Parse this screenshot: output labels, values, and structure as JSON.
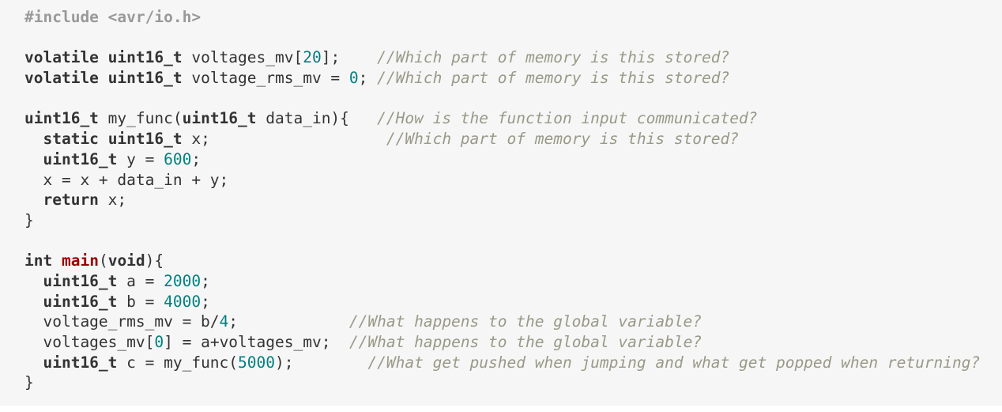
{
  "colors": {
    "background": "#f6f6f6",
    "text": "#333333",
    "keyword": "#333333",
    "preprocessor": "#999999",
    "number": "#008080",
    "function_name": "#990000",
    "comment": "#999988"
  },
  "lines": [
    {
      "tokens": [
        {
          "t": "pp",
          "v": "#include <avr/io.h>"
        }
      ]
    },
    {
      "tokens": []
    },
    {
      "tokens": [
        {
          "t": "kw",
          "v": "volatile"
        },
        {
          "t": "plain",
          "v": " "
        },
        {
          "t": "kw",
          "v": "uint16_t"
        },
        {
          "t": "plain",
          "v": " voltages_mv["
        },
        {
          "t": "num",
          "v": "20"
        },
        {
          "t": "plain",
          "v": "];    "
        },
        {
          "t": "cm",
          "v": "//Which part of memory is this stored?"
        }
      ]
    },
    {
      "tokens": [
        {
          "t": "kw",
          "v": "volatile"
        },
        {
          "t": "plain",
          "v": " "
        },
        {
          "t": "kw",
          "v": "uint16_t"
        },
        {
          "t": "plain",
          "v": " voltage_rms_mv = "
        },
        {
          "t": "num",
          "v": "0"
        },
        {
          "t": "plain",
          "v": "; "
        },
        {
          "t": "cm",
          "v": "//Which part of memory is this stored?"
        }
      ]
    },
    {
      "tokens": []
    },
    {
      "tokens": [
        {
          "t": "kw",
          "v": "uint16_t"
        },
        {
          "t": "plain",
          "v": " my_func("
        },
        {
          "t": "kw",
          "v": "uint16_t"
        },
        {
          "t": "plain",
          "v": " data_in){   "
        },
        {
          "t": "cm",
          "v": "//How is the function input communicated?"
        }
      ]
    },
    {
      "tokens": [
        {
          "t": "plain",
          "v": "  "
        },
        {
          "t": "kw",
          "v": "static"
        },
        {
          "t": "plain",
          "v": " "
        },
        {
          "t": "kw",
          "v": "uint16_t"
        },
        {
          "t": "plain",
          "v": " x;                   "
        },
        {
          "t": "cm",
          "v": "//Which part of memory is this stored?"
        }
      ]
    },
    {
      "tokens": [
        {
          "t": "plain",
          "v": "  "
        },
        {
          "t": "kw",
          "v": "uint16_t"
        },
        {
          "t": "plain",
          "v": " y = "
        },
        {
          "t": "num",
          "v": "600"
        },
        {
          "t": "plain",
          "v": ";"
        }
      ]
    },
    {
      "tokens": [
        {
          "t": "plain",
          "v": "  x = x + data_in + y;"
        }
      ]
    },
    {
      "tokens": [
        {
          "t": "plain",
          "v": "  "
        },
        {
          "t": "kw",
          "v": "return"
        },
        {
          "t": "plain",
          "v": " x;"
        }
      ]
    },
    {
      "tokens": [
        {
          "t": "plain",
          "v": "}"
        }
      ]
    },
    {
      "tokens": []
    },
    {
      "tokens": [
        {
          "t": "kw",
          "v": "int"
        },
        {
          "t": "plain",
          "v": " "
        },
        {
          "t": "fn",
          "v": "main"
        },
        {
          "t": "plain",
          "v": "("
        },
        {
          "t": "kw",
          "v": "void"
        },
        {
          "t": "plain",
          "v": "){"
        }
      ]
    },
    {
      "tokens": [
        {
          "t": "plain",
          "v": "  "
        },
        {
          "t": "kw",
          "v": "uint16_t"
        },
        {
          "t": "plain",
          "v": " a = "
        },
        {
          "t": "num",
          "v": "2000"
        },
        {
          "t": "plain",
          "v": ";"
        }
      ]
    },
    {
      "tokens": [
        {
          "t": "plain",
          "v": "  "
        },
        {
          "t": "kw",
          "v": "uint16_t"
        },
        {
          "t": "plain",
          "v": " b = "
        },
        {
          "t": "num",
          "v": "4000"
        },
        {
          "t": "plain",
          "v": ";"
        }
      ]
    },
    {
      "tokens": [
        {
          "t": "plain",
          "v": "  voltage_rms_mv = b/"
        },
        {
          "t": "num",
          "v": "4"
        },
        {
          "t": "plain",
          "v": ";            "
        },
        {
          "t": "cm",
          "v": "//What happens to the global variable?"
        }
      ]
    },
    {
      "tokens": [
        {
          "t": "plain",
          "v": "  voltages_mv["
        },
        {
          "t": "num",
          "v": "0"
        },
        {
          "t": "plain",
          "v": "] = a+voltages_mv;  "
        },
        {
          "t": "cm",
          "v": "//What happens to the global variable?"
        }
      ]
    },
    {
      "tokens": [
        {
          "t": "plain",
          "v": "  "
        },
        {
          "t": "kw",
          "v": "uint16_t"
        },
        {
          "t": "plain",
          "v": " c = my_func("
        },
        {
          "t": "num",
          "v": "5000"
        },
        {
          "t": "plain",
          "v": ");        "
        },
        {
          "t": "cm",
          "v": "//What get pushed when jumping and what get popped when returning?"
        }
      ]
    },
    {
      "tokens": [
        {
          "t": "plain",
          "v": "}"
        }
      ]
    }
  ]
}
